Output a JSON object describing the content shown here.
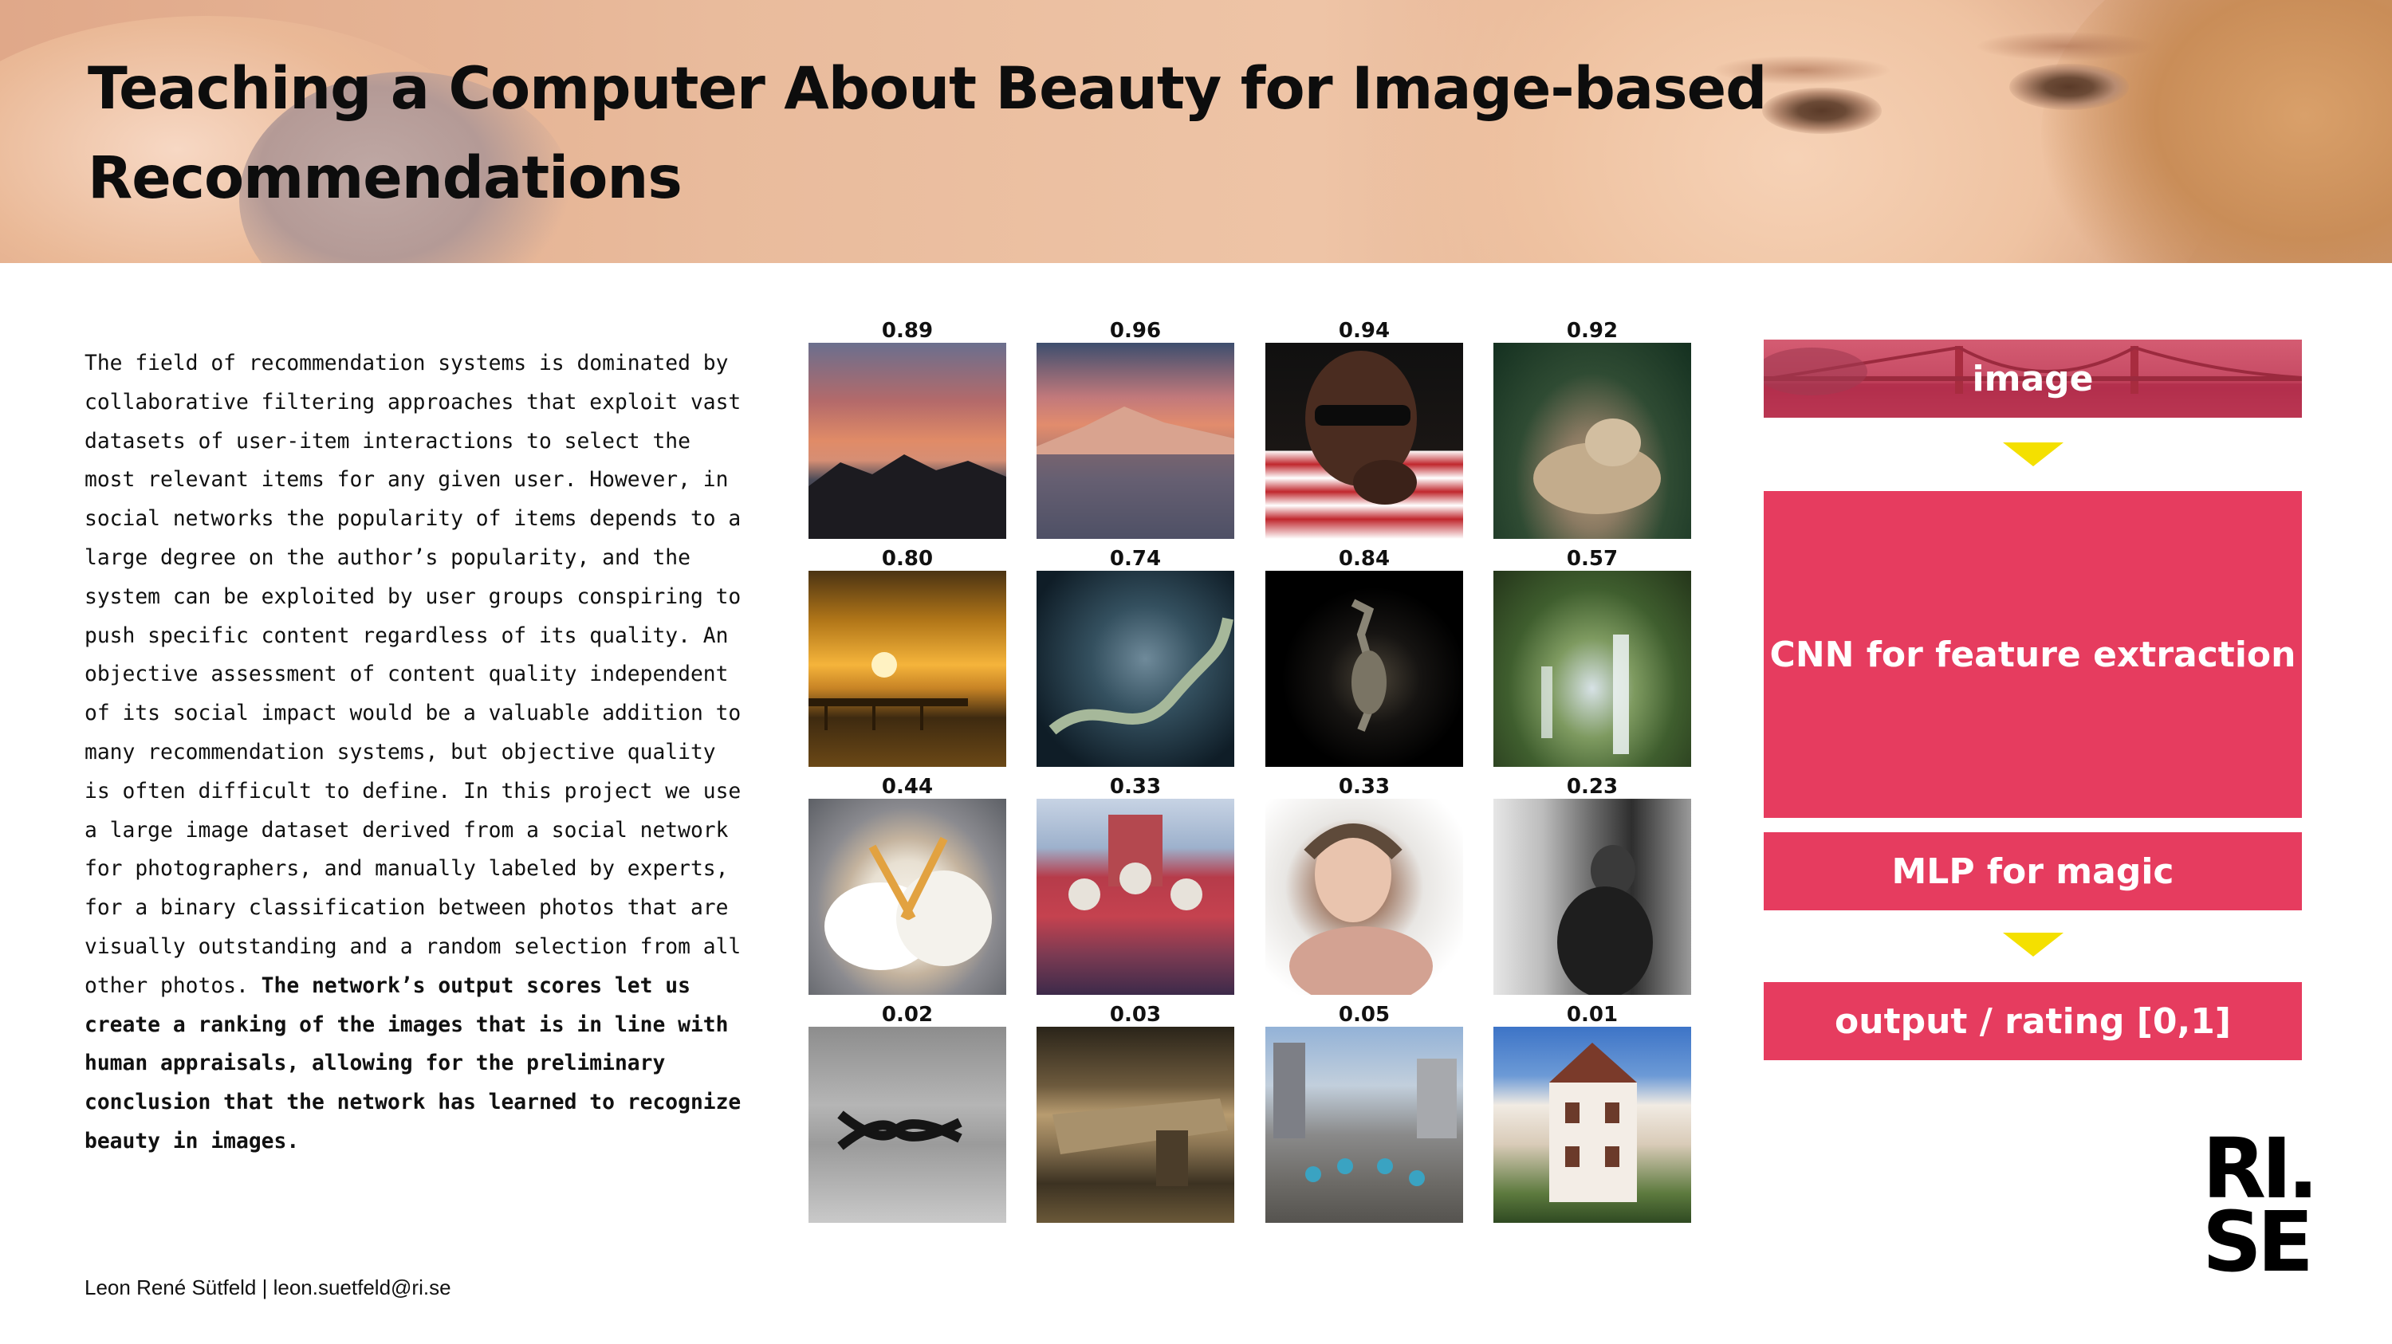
{
  "title": "Teaching a Computer About Beauty for Image-based Recommendations",
  "abstract": {
    "text": "The field of recommendation systems is dominated by collaborative filtering approaches that exploit vast datasets of user-item interactions to select the most relevant items for any given user. However, in social networks the popularity of items depends to a large degree on the author’s popularity, and the system can be exploited by user groups conspiring to push specific content regardless of its quality. An objective assessment of content quality independent of its social impact would be a valuable addition to many recommendation systems, but objective quality is often difficult to define. In this project we use a large image dataset derived from a social network for photographers, and manually labeled by experts, for a binary classification between photos that are visually outstanding and a random selection from all other photos.",
    "bold_text": "The network’s output scores let us create a ranking of the images that is in line with human appraisals, allowing for the preliminary conclusion that the network has learned to recognize beauty in images."
  },
  "footer": "Leon René Sütfeld | leon.suetfeld@ri.se",
  "image_grid": {
    "scores": [
      "0.89",
      "0.96",
      "0.94",
      "0.92",
      "0.80",
      "0.74",
      "0.84",
      "0.57",
      "0.44",
      "0.33",
      "0.33",
      "0.23",
      "0.02",
      "0.03",
      "0.05",
      "0.01"
    ]
  },
  "pipeline": {
    "input_label": "image",
    "cnn_label": "CNN for feature extraction",
    "mlp_label": "MLP for magic",
    "output_label": "output / rating [0,1]",
    "box_color": "#e63c5f",
    "arrow_color": "#f4e000"
  },
  "logo": {
    "line1": "RI.",
    "line2": "SE"
  }
}
